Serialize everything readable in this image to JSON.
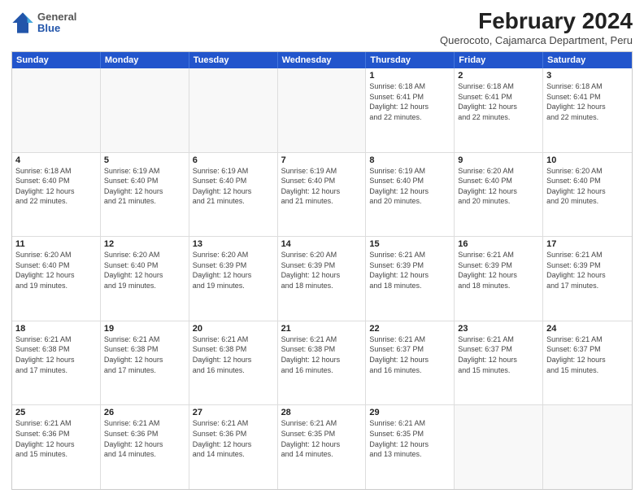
{
  "logo": {
    "general": "General",
    "blue": "Blue"
  },
  "title": "February 2024",
  "subtitle": "Querocoto, Cajamarca Department, Peru",
  "header": {
    "days": [
      "Sunday",
      "Monday",
      "Tuesday",
      "Wednesday",
      "Thursday",
      "Friday",
      "Saturday"
    ]
  },
  "weeks": [
    [
      {
        "day": "",
        "info": ""
      },
      {
        "day": "",
        "info": ""
      },
      {
        "day": "",
        "info": ""
      },
      {
        "day": "",
        "info": ""
      },
      {
        "day": "1",
        "info": "Sunrise: 6:18 AM\nSunset: 6:41 PM\nDaylight: 12 hours\nand 22 minutes."
      },
      {
        "day": "2",
        "info": "Sunrise: 6:18 AM\nSunset: 6:41 PM\nDaylight: 12 hours\nand 22 minutes."
      },
      {
        "day": "3",
        "info": "Sunrise: 6:18 AM\nSunset: 6:41 PM\nDaylight: 12 hours\nand 22 minutes."
      }
    ],
    [
      {
        "day": "4",
        "info": "Sunrise: 6:18 AM\nSunset: 6:40 PM\nDaylight: 12 hours\nand 22 minutes."
      },
      {
        "day": "5",
        "info": "Sunrise: 6:19 AM\nSunset: 6:40 PM\nDaylight: 12 hours\nand 21 minutes."
      },
      {
        "day": "6",
        "info": "Sunrise: 6:19 AM\nSunset: 6:40 PM\nDaylight: 12 hours\nand 21 minutes."
      },
      {
        "day": "7",
        "info": "Sunrise: 6:19 AM\nSunset: 6:40 PM\nDaylight: 12 hours\nand 21 minutes."
      },
      {
        "day": "8",
        "info": "Sunrise: 6:19 AM\nSunset: 6:40 PM\nDaylight: 12 hours\nand 20 minutes."
      },
      {
        "day": "9",
        "info": "Sunrise: 6:20 AM\nSunset: 6:40 PM\nDaylight: 12 hours\nand 20 minutes."
      },
      {
        "day": "10",
        "info": "Sunrise: 6:20 AM\nSunset: 6:40 PM\nDaylight: 12 hours\nand 20 minutes."
      }
    ],
    [
      {
        "day": "11",
        "info": "Sunrise: 6:20 AM\nSunset: 6:40 PM\nDaylight: 12 hours\nand 19 minutes."
      },
      {
        "day": "12",
        "info": "Sunrise: 6:20 AM\nSunset: 6:40 PM\nDaylight: 12 hours\nand 19 minutes."
      },
      {
        "day": "13",
        "info": "Sunrise: 6:20 AM\nSunset: 6:39 PM\nDaylight: 12 hours\nand 19 minutes."
      },
      {
        "day": "14",
        "info": "Sunrise: 6:20 AM\nSunset: 6:39 PM\nDaylight: 12 hours\nand 18 minutes."
      },
      {
        "day": "15",
        "info": "Sunrise: 6:21 AM\nSunset: 6:39 PM\nDaylight: 12 hours\nand 18 minutes."
      },
      {
        "day": "16",
        "info": "Sunrise: 6:21 AM\nSunset: 6:39 PM\nDaylight: 12 hours\nand 18 minutes."
      },
      {
        "day": "17",
        "info": "Sunrise: 6:21 AM\nSunset: 6:39 PM\nDaylight: 12 hours\nand 17 minutes."
      }
    ],
    [
      {
        "day": "18",
        "info": "Sunrise: 6:21 AM\nSunset: 6:38 PM\nDaylight: 12 hours\nand 17 minutes."
      },
      {
        "day": "19",
        "info": "Sunrise: 6:21 AM\nSunset: 6:38 PM\nDaylight: 12 hours\nand 17 minutes."
      },
      {
        "day": "20",
        "info": "Sunrise: 6:21 AM\nSunset: 6:38 PM\nDaylight: 12 hours\nand 16 minutes."
      },
      {
        "day": "21",
        "info": "Sunrise: 6:21 AM\nSunset: 6:38 PM\nDaylight: 12 hours\nand 16 minutes."
      },
      {
        "day": "22",
        "info": "Sunrise: 6:21 AM\nSunset: 6:37 PM\nDaylight: 12 hours\nand 16 minutes."
      },
      {
        "day": "23",
        "info": "Sunrise: 6:21 AM\nSunset: 6:37 PM\nDaylight: 12 hours\nand 15 minutes."
      },
      {
        "day": "24",
        "info": "Sunrise: 6:21 AM\nSunset: 6:37 PM\nDaylight: 12 hours\nand 15 minutes."
      }
    ],
    [
      {
        "day": "25",
        "info": "Sunrise: 6:21 AM\nSunset: 6:36 PM\nDaylight: 12 hours\nand 15 minutes."
      },
      {
        "day": "26",
        "info": "Sunrise: 6:21 AM\nSunset: 6:36 PM\nDaylight: 12 hours\nand 14 minutes."
      },
      {
        "day": "27",
        "info": "Sunrise: 6:21 AM\nSunset: 6:36 PM\nDaylight: 12 hours\nand 14 minutes."
      },
      {
        "day": "28",
        "info": "Sunrise: 6:21 AM\nSunset: 6:35 PM\nDaylight: 12 hours\nand 14 minutes."
      },
      {
        "day": "29",
        "info": "Sunrise: 6:21 AM\nSunset: 6:35 PM\nDaylight: 12 hours\nand 13 minutes."
      },
      {
        "day": "",
        "info": ""
      },
      {
        "day": "",
        "info": ""
      }
    ]
  ]
}
